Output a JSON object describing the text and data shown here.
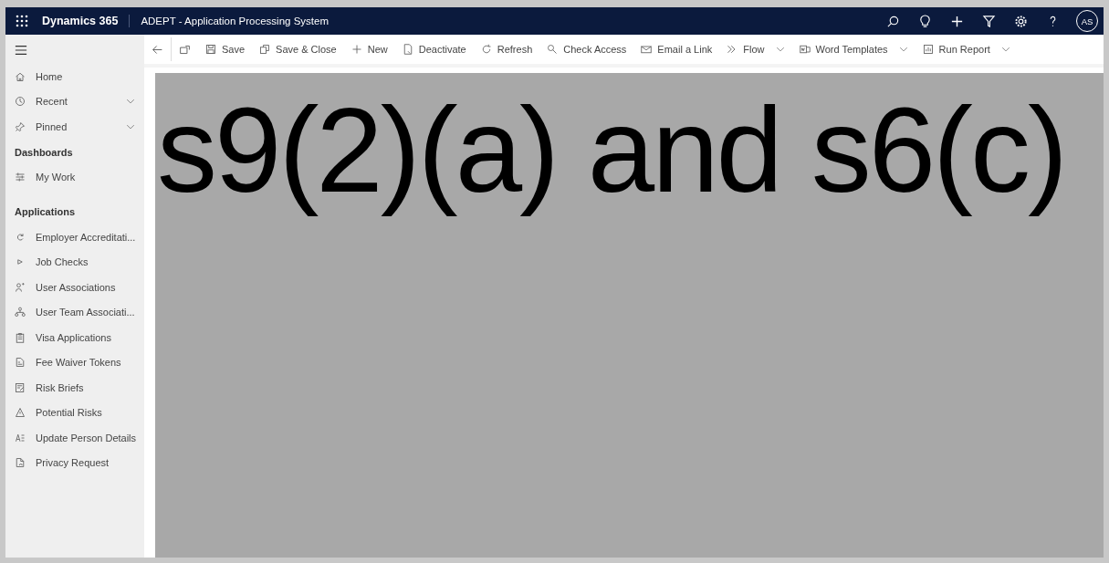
{
  "header": {
    "brand": "Dynamics 365",
    "app_title": "ADEPT - Application Processing System",
    "avatar": "AS"
  },
  "sidebar": {
    "items": [
      {
        "kind": "item",
        "label": "Home",
        "expandable": false
      },
      {
        "kind": "item",
        "label": "Recent",
        "expandable": true
      },
      {
        "kind": "item",
        "label": "Pinned",
        "expandable": true
      },
      {
        "kind": "header",
        "label": "Dashboards"
      },
      {
        "kind": "item",
        "label": "My Work",
        "expandable": false
      },
      {
        "kind": "header",
        "label": "Applications"
      },
      {
        "kind": "item",
        "label": "Employer Accreditati...",
        "expandable": false
      },
      {
        "kind": "item",
        "label": "Job Checks",
        "expandable": false
      },
      {
        "kind": "item",
        "label": "User Associations",
        "expandable": false
      },
      {
        "kind": "item",
        "label": "User Team Associati...",
        "expandable": false
      },
      {
        "kind": "item",
        "label": "Visa Applications",
        "expandable": false
      },
      {
        "kind": "item",
        "label": "Fee Waiver Tokens",
        "expandable": false
      },
      {
        "kind": "item",
        "label": "Risk Briefs",
        "expandable": false
      },
      {
        "kind": "item",
        "label": "Potential Risks",
        "expandable": false
      },
      {
        "kind": "item",
        "label": "Update Person Details",
        "expandable": false
      },
      {
        "kind": "item",
        "label": "Privacy Request",
        "expandable": false
      }
    ]
  },
  "toolbar": {
    "buttons": [
      {
        "label": "Save",
        "has_menu": false
      },
      {
        "label": "Save & Close",
        "has_menu": false
      },
      {
        "label": "New",
        "has_menu": false
      },
      {
        "label": "Deactivate",
        "has_menu": false
      },
      {
        "label": "Refresh",
        "has_menu": false
      },
      {
        "label": "Check Access",
        "has_menu": false
      },
      {
        "label": "Email a Link",
        "has_menu": false
      },
      {
        "label": "Flow",
        "has_menu": true
      },
      {
        "label": "Word Templates",
        "has_menu": true
      },
      {
        "label": "Run Report",
        "has_menu": true
      }
    ]
  },
  "redaction": {
    "text": "s9(2)(a) and s6(c)"
  }
}
